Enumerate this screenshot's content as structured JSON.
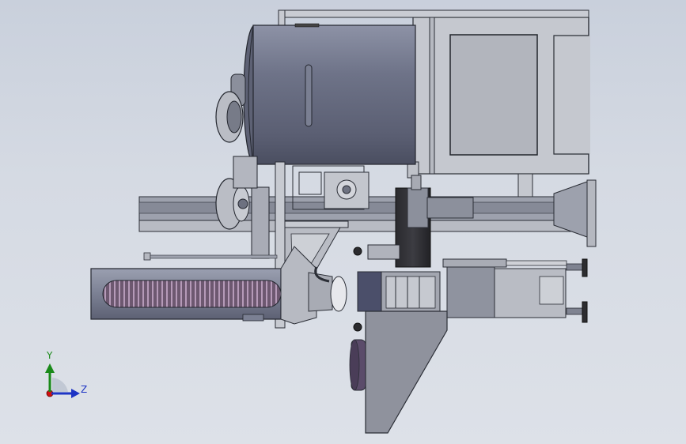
{
  "viewport": {
    "background_top": "#c9d0dc",
    "background_bottom": "#dde1e8"
  },
  "triad": {
    "y_label": "Y",
    "z_label": "Z",
    "y_color": "#1a8a1a",
    "z_color": "#1d34c4",
    "origin_color": "#d01010"
  }
}
